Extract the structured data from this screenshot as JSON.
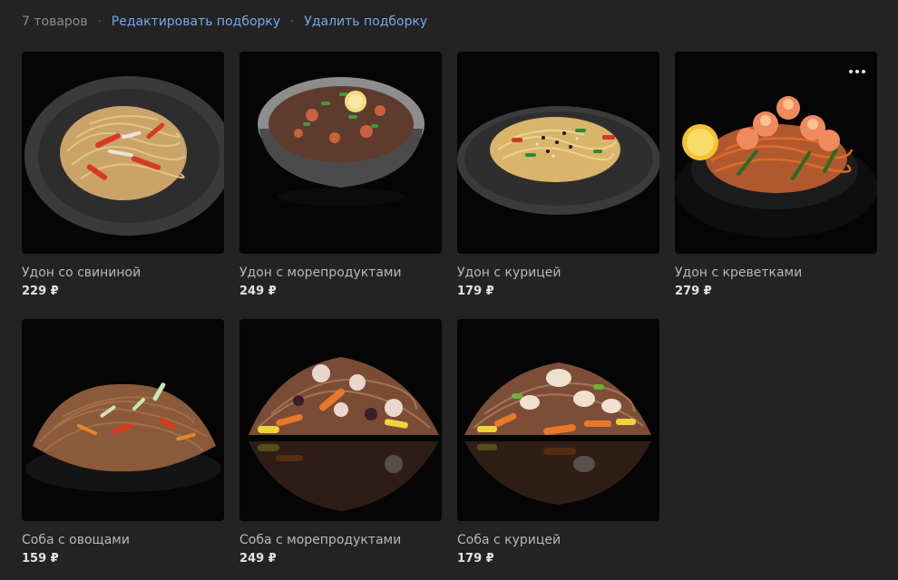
{
  "header": {
    "count": "7 товаров",
    "separator": "·",
    "edit_link": "Редактировать подборку",
    "delete_link": "Удалить подборку"
  },
  "products": [
    {
      "title": "Удон со свининой",
      "price": "229 ₽",
      "image": "udon-pork-photo"
    },
    {
      "title": "Удон с морепродуктами",
      "price": "249 ₽",
      "image": "udon-seafood-photo"
    },
    {
      "title": "Удон с курицей",
      "price": "179 ₽",
      "image": "udon-chicken-photo"
    },
    {
      "title": "Удон с креветками",
      "price": "279 ₽",
      "image": "udon-shrimp-photo",
      "has_menu": true
    },
    {
      "title": "Соба с овощами",
      "price": "159 ₽",
      "image": "soba-vegetables-photo"
    },
    {
      "title": "Соба с морепродуктами",
      "price": "249 ₽",
      "image": "soba-seafood-photo"
    },
    {
      "title": "Соба с курицей",
      "price": "179 ₽",
      "image": "soba-chicken-photo"
    }
  ],
  "colors": {
    "background": "#232323",
    "link": "#71aaeb",
    "muted_text": "#8c8c8c",
    "title_text": "#b8b8b8",
    "price_text": "#e1e3e6"
  }
}
